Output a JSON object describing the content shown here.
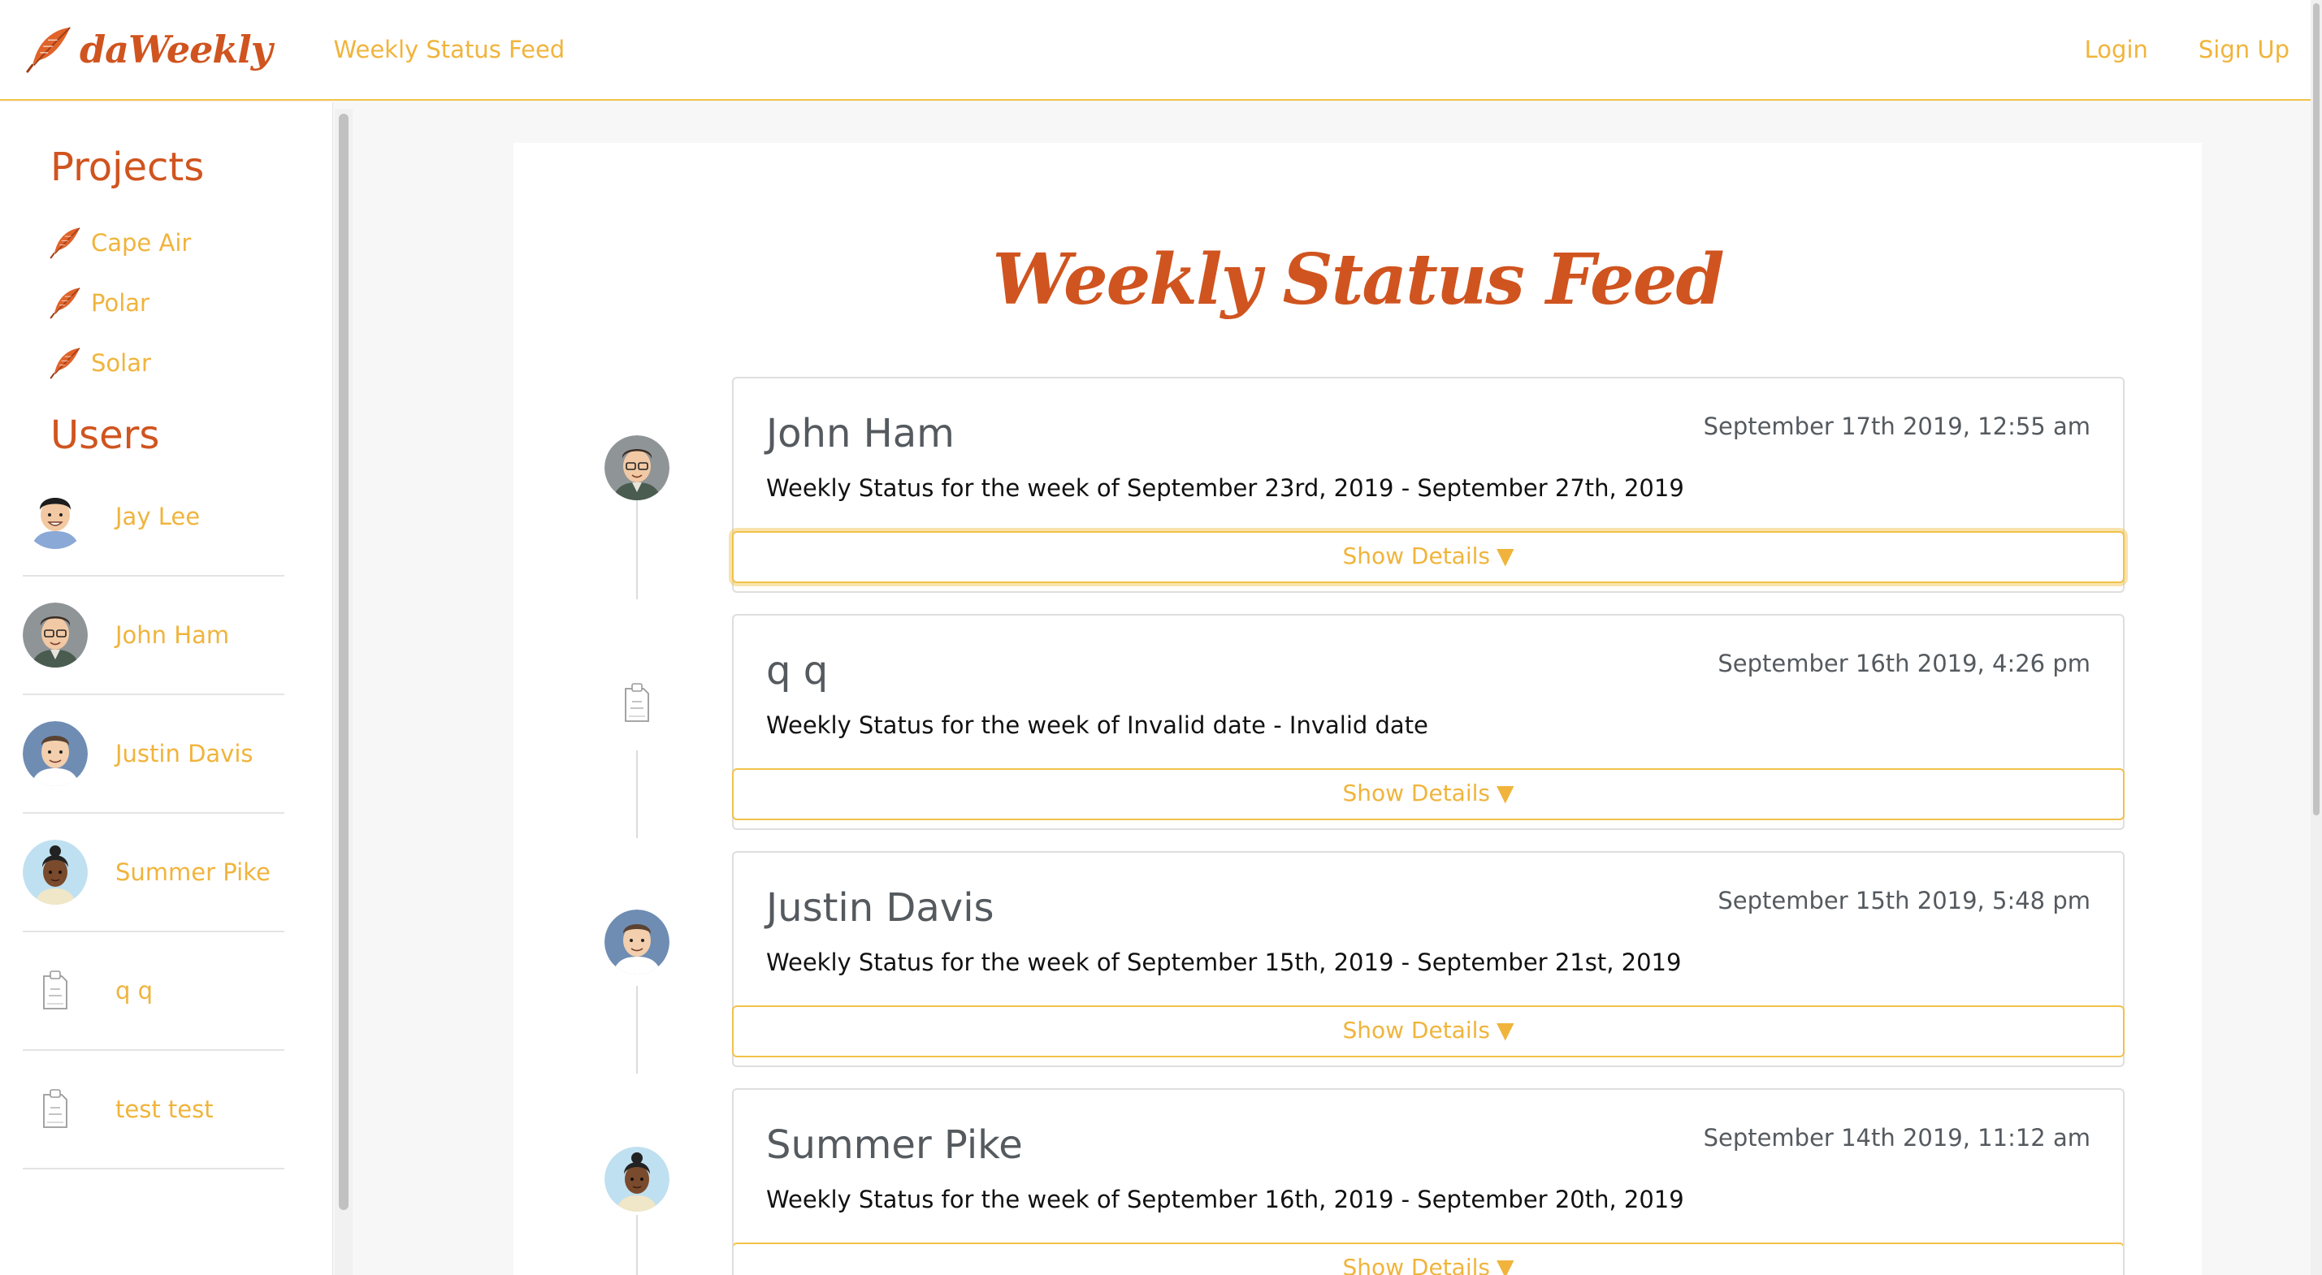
{
  "navbar": {
    "brand": "daWeekly",
    "feed_link": "Weekly Status Feed",
    "login": "Login",
    "signup": "Sign Up"
  },
  "sidebar": {
    "projects_heading": "Projects",
    "projects": [
      "Cape Air",
      "Polar",
      "Solar"
    ],
    "users_heading": "Users",
    "users": [
      "Jay Lee",
      "John Ham",
      "Justin Davis",
      "Summer Pike",
      "q q",
      "test test"
    ]
  },
  "main": {
    "title": "Weekly Status Feed",
    "entries": [
      {
        "name": "John Ham",
        "date": "September 17th 2019, 12:55 am",
        "week": "Weekly Status for the week of September 23rd, 2019 - September 27th, 2019",
        "button": "Show Details",
        "arrow": "▼"
      },
      {
        "name": "q q",
        "date": "September 16th 2019, 4:26 pm",
        "week": "Weekly Status for the week of Invalid date - Invalid date",
        "button": "Show Details",
        "arrow": "▼"
      },
      {
        "name": "Justin Davis",
        "date": "September 15th 2019, 5:48 pm",
        "week": "Weekly Status for the week of September 15th, 2019 - September 21st, 2019",
        "button": "Show Details",
        "arrow": "▼"
      },
      {
        "name": "Summer Pike",
        "date": "September 14th 2019, 11:12 am",
        "week": "Weekly Status for the week of September 16th, 2019 - September 20th, 2019",
        "button": "Show Details",
        "arrow": "▼"
      }
    ]
  },
  "colors": {
    "brand_orange": "#d0541f",
    "link_yellow": "#f0b43c",
    "border_yellow": "#f1c24a"
  }
}
